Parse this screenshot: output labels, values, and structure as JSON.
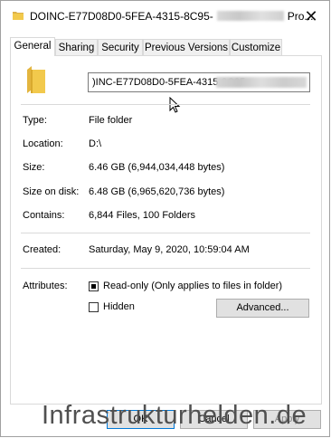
{
  "window": {
    "title_prefix": "DOINC-E77D08D0-5FEA-4315-8C95-",
    "title_suffix": "Pro...",
    "close_glyph": "✕"
  },
  "tabs": [
    {
      "label": "General",
      "active": true
    },
    {
      "label": "Sharing"
    },
    {
      "label": "Security"
    },
    {
      "label": "Previous Versions"
    },
    {
      "label": "Customize"
    }
  ],
  "general": {
    "folder_name": ")INC-E77D08D0-5FEA-4315-8C95-",
    "props": {
      "type": {
        "label": "Type:",
        "value": "File folder"
      },
      "location": {
        "label": "Location:",
        "value": "D:\\"
      },
      "size": {
        "label": "Size:",
        "value": "6.46 GB (6,944,034,448 bytes)"
      },
      "size_on_disk": {
        "label": "Size on disk:",
        "value": "6.48 GB (6,965,620,736 bytes)"
      },
      "contains": {
        "label": "Contains:",
        "value": "6,844 Files, 100 Folders"
      },
      "created": {
        "label": "Created:",
        "value": "Saturday, May 9, 2020, 10:59:04 AM"
      }
    },
    "attributes": {
      "label": "Attributes:",
      "readonly_label": "Read-only (Only applies to files in folder)",
      "readonly_state": "indeterminate",
      "hidden_label": "Hidden",
      "hidden_state": "unchecked",
      "advanced_label": "Advanced..."
    }
  },
  "footer": {
    "ok_label": "OK",
    "cancel_label": "Cancel",
    "apply_label": "Apply"
  },
  "watermark": "Infrastrukturhelden.de",
  "colors": {
    "folder": "#f2c94c",
    "accent": "#0078d7"
  }
}
